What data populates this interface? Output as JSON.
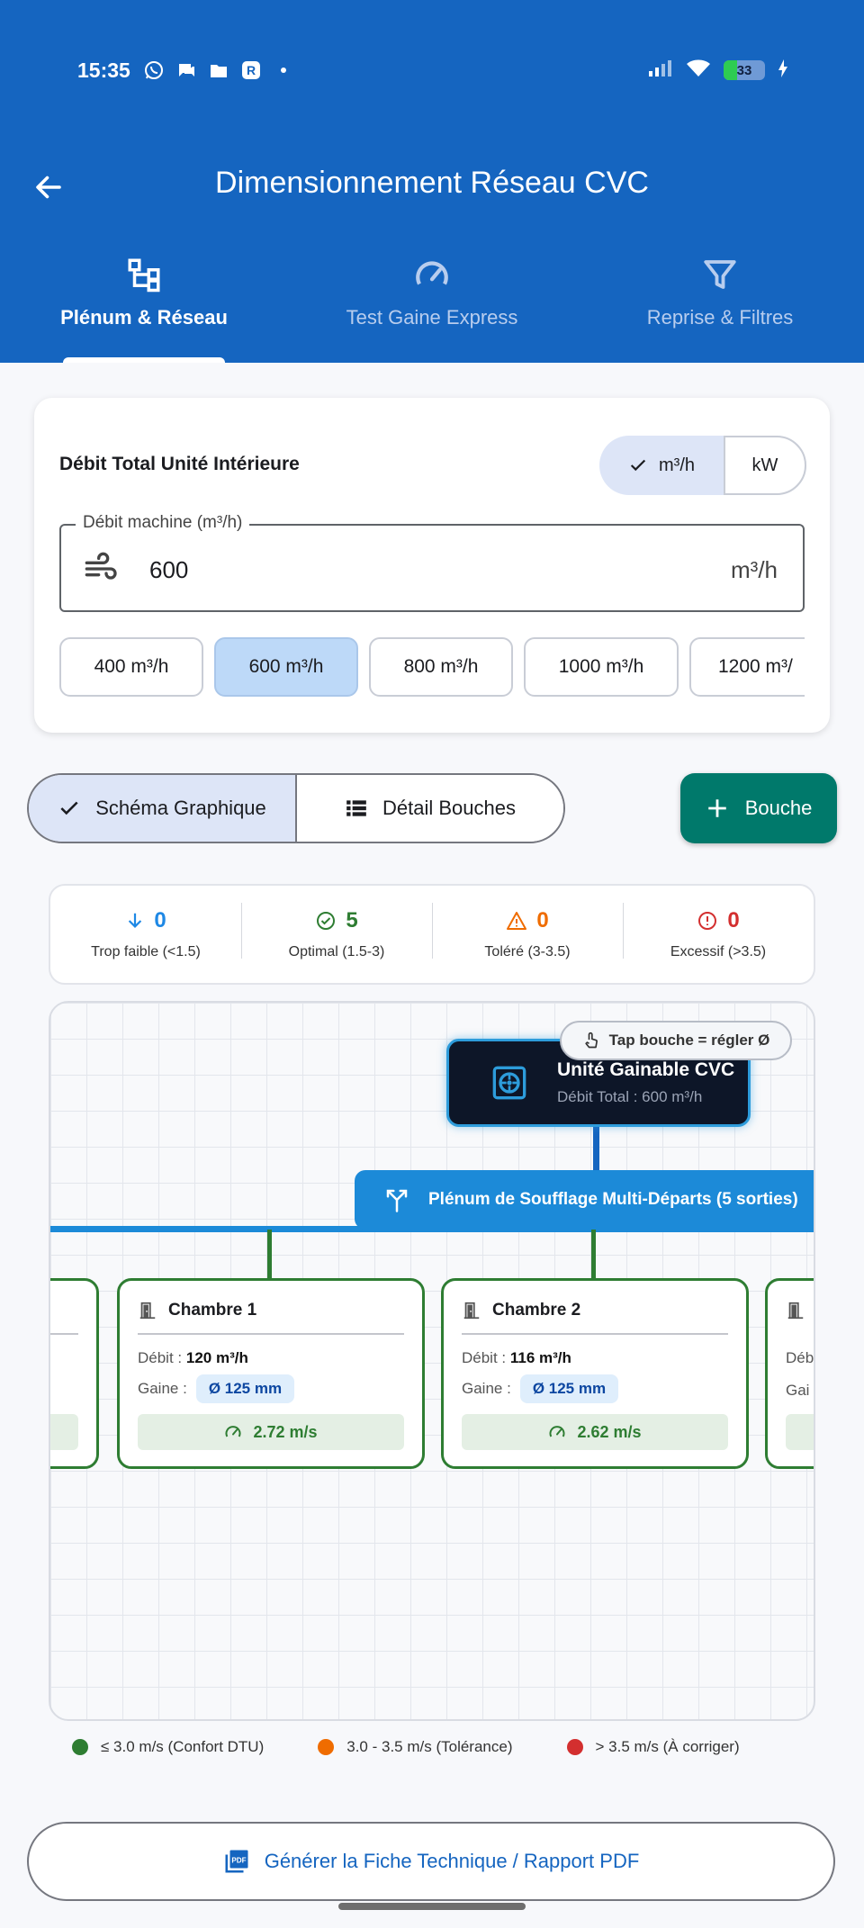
{
  "status_bar": {
    "time": "15:35",
    "battery": "33",
    "battery_level": 0.33
  },
  "header": {
    "title": "Dimensionnement Réseau CVC",
    "tabs": [
      {
        "label": "Plénum & Réseau",
        "icon": "network-icon",
        "active": true
      },
      {
        "label": "Test Gaine Express",
        "icon": "speedometer-icon",
        "active": false
      },
      {
        "label": "Reprise & Filtres",
        "icon": "filter-icon",
        "active": false
      }
    ]
  },
  "flow_card": {
    "title": "Débit Total Unité Intérieure",
    "unit_toggle": {
      "selected": "m³/h",
      "other": "kW"
    },
    "input": {
      "label": "Débit machine (m³/h)",
      "value": "600",
      "suffix": "m³/h"
    },
    "presets": [
      "400 m³/h",
      "600 m³/h",
      "800 m³/h",
      "1000 m³/h",
      "1200 m³/"
    ],
    "selected_preset": "600 m³/h"
  },
  "view_toggle": {
    "graphic": "Schéma Graphique",
    "detail": "Détail Bouches"
  },
  "add_button": "Bouche",
  "stats": [
    {
      "value": "0",
      "label": "Trop faible (<1.5)",
      "color": "#1e88e5",
      "icon": "arrow-down-icon"
    },
    {
      "value": "5",
      "label": "Optimal (1.5-3)",
      "color": "#2e7d32",
      "icon": "check-circle-icon"
    },
    {
      "value": "0",
      "label": "Toléré (3-3.5)",
      "color": "#ef6c00",
      "icon": "warning-icon"
    },
    {
      "value": "0",
      "label": "Excessif (>3.5)",
      "color": "#d32f2f",
      "icon": "error-icon"
    }
  ],
  "diagram": {
    "tip": "Tap bouche = régler Ø",
    "unit": {
      "title": "Unité Gainable CVC",
      "subtitle": "Débit Total : 600 m³/h"
    },
    "plenum": "Plénum de Soufflage Multi-Départs (5 sorties)",
    "rooms": [
      {
        "name": "Chambre 1",
        "debit_label": "Débit :",
        "debit": "120 m³/h",
        "gaine_label": "Gaine :",
        "gaine": "Ø 125 mm",
        "speed": "2.72 m/s"
      },
      {
        "name": "Chambre 2",
        "debit_label": "Débit :",
        "debit": "116 m³/h",
        "gaine_label": "Gaine :",
        "gaine": "Ø 125 mm",
        "speed": "2.62 m/s"
      }
    ],
    "partial_right": {
      "debit_label": "Déb",
      "gaine_label": "Gai"
    }
  },
  "legend": [
    {
      "label": "≤ 3.0 m/s (Confort DTU)",
      "color": "#2e7d32"
    },
    {
      "label": "3.0 - 3.5 m/s (Tolérance)",
      "color": "#ef6c00"
    },
    {
      "label": "> 3.5 m/s (À corriger)",
      "color": "#d32f2f"
    }
  ],
  "pdf_button": "Générer la Fiche Technique / Rapport PDF"
}
